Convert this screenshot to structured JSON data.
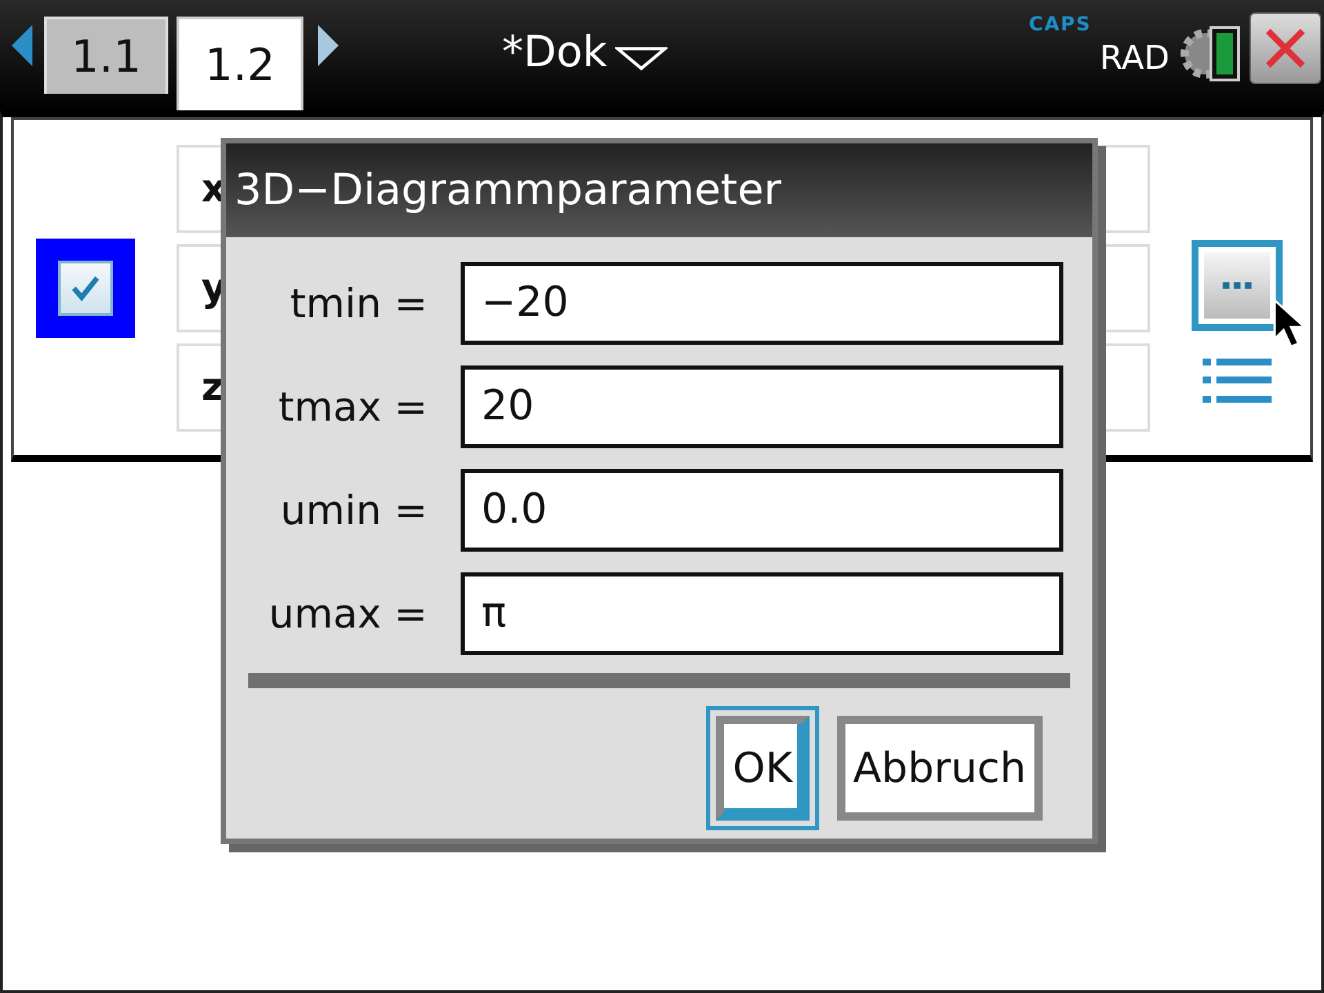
{
  "tabs": [
    {
      "label": "1.1",
      "selected": false
    },
    {
      "label": "1.2",
      "selected": true
    }
  ],
  "document": {
    "title": "*Dok"
  },
  "status": {
    "caps": "CAPS",
    "angle_mode": "RAD"
  },
  "function_entry": {
    "checked": true,
    "fields": [
      {
        "label": "x"
      },
      {
        "label": "y"
      },
      {
        "label": "z"
      }
    ]
  },
  "dialog": {
    "title": "3D−Diagrammparameter",
    "fields": [
      {
        "label": "tmin =",
        "value": "−20"
      },
      {
        "label": "tmax =",
        "value": "20"
      },
      {
        "label": "umin =",
        "value": "0.0"
      },
      {
        "label": "umax =",
        "value": "π"
      }
    ],
    "buttons": [
      {
        "label": "OK",
        "selected": true
      },
      {
        "label": "Abbruch",
        "selected": false
      }
    ]
  }
}
